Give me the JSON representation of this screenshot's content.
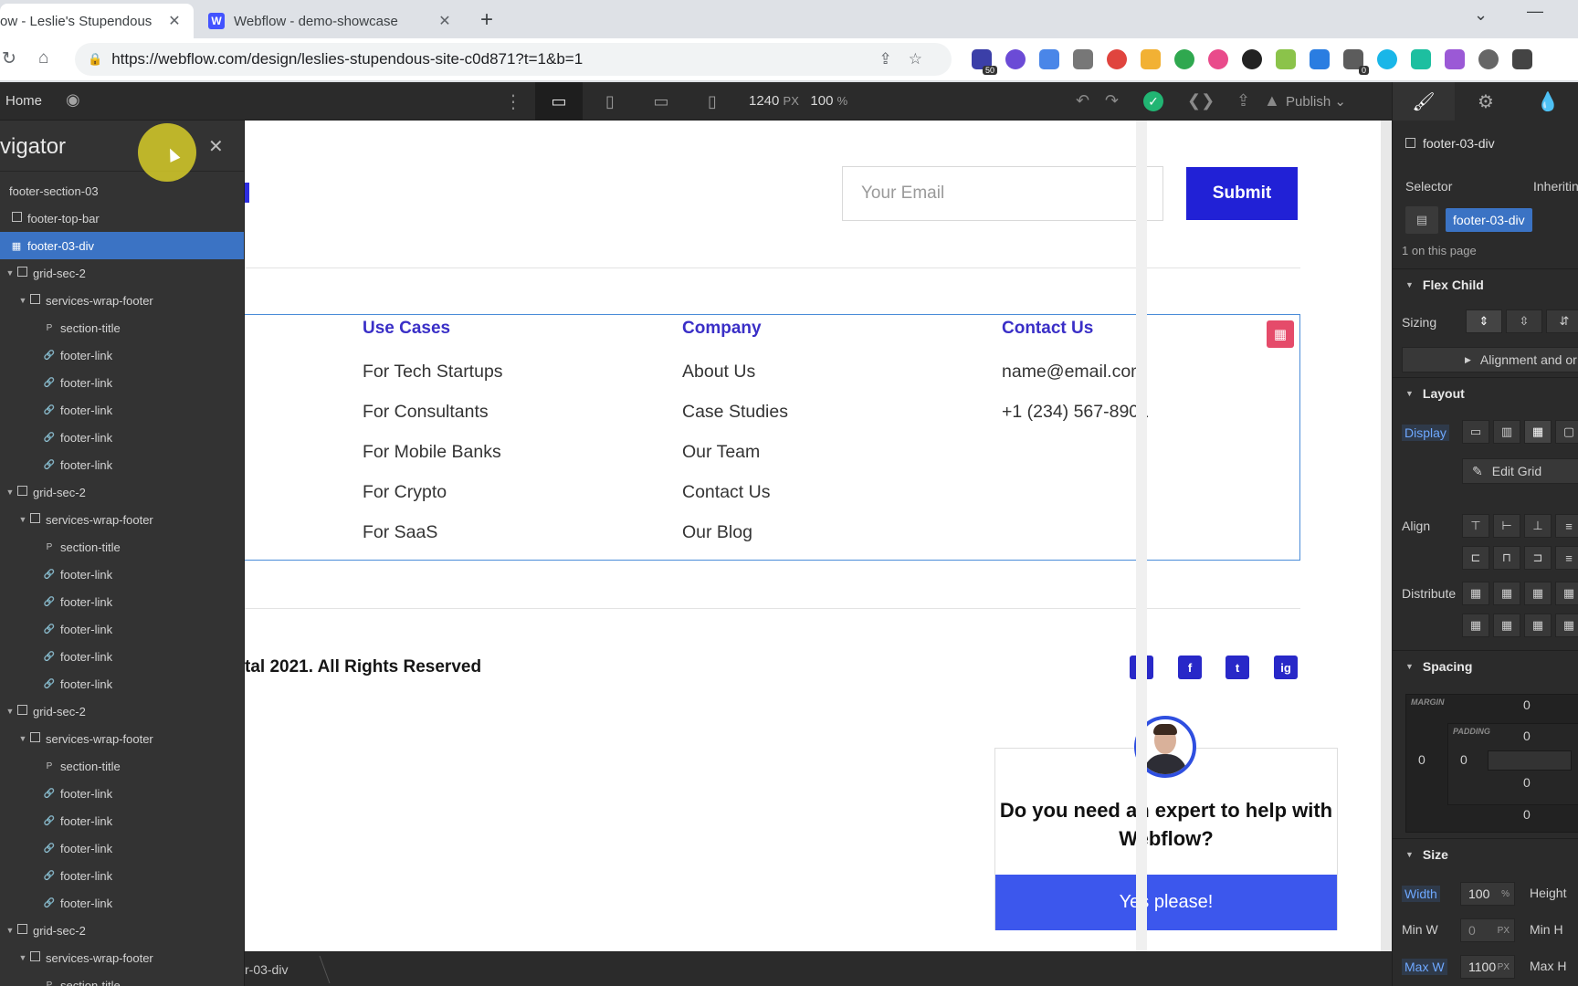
{
  "browser": {
    "tabs": [
      {
        "title": "ow - Leslie's Stupendous",
        "active": true
      },
      {
        "title": "Webflow - demo-showcase",
        "active": false,
        "favicon": "W"
      }
    ],
    "url": "https://webflow.com/design/leslies-stupendous-site-c0d871?t=1&b=1",
    "extension_badges": {
      "first": "50",
      "second": "0"
    }
  },
  "topbar": {
    "home": "Home",
    "width_value": "1240",
    "width_unit": "PX",
    "zoom_value": "100",
    "zoom_unit": "%",
    "publish": "Publish"
  },
  "navigator": {
    "title": "vigator",
    "items": [
      {
        "label": "footer-section-03",
        "depth": 0,
        "icon": "none"
      },
      {
        "label": "footer-top-bar",
        "depth": 0,
        "icon": "box"
      },
      {
        "label": "footer-03-div",
        "depth": 0,
        "icon": "grid",
        "selected": true
      },
      {
        "label": "grid-sec-2",
        "depth": 1,
        "icon": "box",
        "caret": true
      },
      {
        "label": "services-wrap-footer",
        "depth": 2,
        "icon": "box",
        "caret": true
      },
      {
        "label": "section-title",
        "depth": 3,
        "icon": "p"
      },
      {
        "label": "footer-link",
        "depth": 3,
        "icon": "link"
      },
      {
        "label": "footer-link",
        "depth": 3,
        "icon": "link"
      },
      {
        "label": "footer-link",
        "depth": 3,
        "icon": "link"
      },
      {
        "label": "footer-link",
        "depth": 3,
        "icon": "link"
      },
      {
        "label": "footer-link",
        "depth": 3,
        "icon": "link"
      },
      {
        "label": "grid-sec-2",
        "depth": 1,
        "icon": "box",
        "caret": true
      },
      {
        "label": "services-wrap-footer",
        "depth": 2,
        "icon": "box",
        "caret": true
      },
      {
        "label": "section-title",
        "depth": 3,
        "icon": "p"
      },
      {
        "label": "footer-link",
        "depth": 3,
        "icon": "link"
      },
      {
        "label": "footer-link",
        "depth": 3,
        "icon": "link"
      },
      {
        "label": "footer-link",
        "depth": 3,
        "icon": "link"
      },
      {
        "label": "footer-link",
        "depth": 3,
        "icon": "link"
      },
      {
        "label": "footer-link",
        "depth": 3,
        "icon": "link"
      },
      {
        "label": "grid-sec-2",
        "depth": 1,
        "icon": "box",
        "caret": true
      },
      {
        "label": "services-wrap-footer",
        "depth": 2,
        "icon": "box",
        "caret": true
      },
      {
        "label": "section-title",
        "depth": 3,
        "icon": "p"
      },
      {
        "label": "footer-link",
        "depth": 3,
        "icon": "link"
      },
      {
        "label": "footer-link",
        "depth": 3,
        "icon": "link"
      },
      {
        "label": "footer-link",
        "depth": 3,
        "icon": "link"
      },
      {
        "label": "footer-link",
        "depth": 3,
        "icon": "link"
      },
      {
        "label": "footer-link",
        "depth": 3,
        "icon": "link"
      },
      {
        "label": "grid-sec-2",
        "depth": 1,
        "icon": "box",
        "caret": true
      },
      {
        "label": "services-wrap-footer",
        "depth": 2,
        "icon": "box",
        "caret": true
      },
      {
        "label": "section-title",
        "depth": 3,
        "icon": "p"
      }
    ]
  },
  "canvas": {
    "email_placeholder": "Your Email",
    "submit": "Submit",
    "columns": [
      {
        "title": "Use Cases",
        "links": [
          "For Tech Startups",
          "For Consultants",
          "For Mobile Banks",
          "For Crypto",
          "For SaaS"
        ]
      },
      {
        "title": "Company",
        "links": [
          "About Us",
          "Case Studies",
          "Our Team",
          "Contact Us",
          "Our Blog"
        ]
      },
      {
        "title": "Contact Us",
        "links": [
          "name@email.com",
          "+1 (234) 567-8901"
        ]
      }
    ],
    "rights": "tal 2021. All Rights Reserved",
    "social": [
      "in",
      "f",
      "t",
      "ig"
    ],
    "expert_question": "Do you need an expert to help with Webflow?",
    "expert_button": "Yes please!"
  },
  "breadcrumb": "r-03-div",
  "panel": {
    "element": "footer-03-div",
    "selector_label": "Selector",
    "inheriting": "Inheritin",
    "selector_tag": "footer-03-div",
    "on_page": "1 on this page",
    "flex_child": "Flex Child",
    "sizing": "Sizing",
    "alignment": "Alignment and or",
    "layout": "Layout",
    "display": "Display",
    "edit_grid": "Edit Grid",
    "align": "Align",
    "distribute": "Distribute",
    "spacing": "Spacing",
    "margin_cap": "MARGIN",
    "padding_cap": "PADDING",
    "margin_top": "0",
    "margin_left": "0",
    "padding_top": "0",
    "padding_left": "0",
    "padding_bottom": "0",
    "margin_bottom": "0",
    "size": "Size",
    "width_label": "Width",
    "width_value": "100",
    "width_unit": "%",
    "height_label": "Height",
    "minw_label": "Min W",
    "minw_value": "0",
    "minw_unit": "PX",
    "minh_label": "Min H",
    "maxw_label": "Max W",
    "maxw_value": "1100",
    "maxw_unit": "PX",
    "maxh_label": "Max H"
  }
}
